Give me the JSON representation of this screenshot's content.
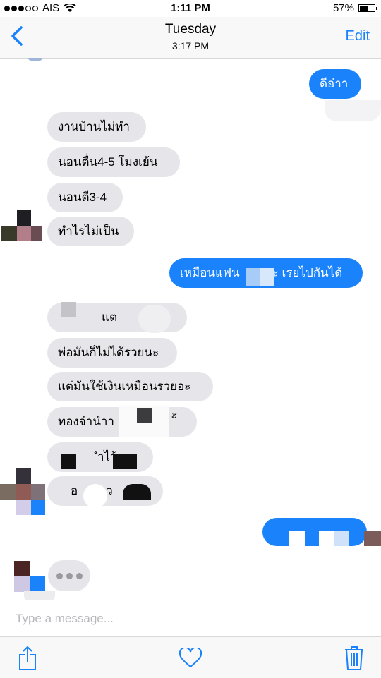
{
  "status": {
    "carrier": "AIS",
    "time": "1:11 PM",
    "battery": "57%",
    "battery_level": 0.57
  },
  "nav": {
    "title": "Tuesday",
    "subtitle": "3:17 PM",
    "edit_label": "Edit",
    "back_icon": "chevron-left-icon"
  },
  "messages": {
    "m1": "ดีอ่าา",
    "m2": "งานบ้านไม่ทำ",
    "m3": "นอนตื่น4-5 โมงเย้น",
    "m4": "นอนตี3-4",
    "m5": "ทำไรไม่เป็น",
    "m6": "เหมือนแฟน",
    "m6b": "ะ เรยไปกันได้",
    "m7": "แต",
    "m8": "พ่อมันก็ไม่ได้รวยนะ",
    "m9": "แต่มันใช้เงินเหมือนรวยอะ",
    "m10": "ทองจำนำา",
    "m10b": "ั้",
    "m11": "ำไว้",
    "m12": "อ",
    "m12b": "ว"
  },
  "input": {
    "placeholder": "Type a message..."
  },
  "toolbar": {
    "share_icon": "share-icon",
    "heart_icon": "heart-icon",
    "trash_icon": "trash-icon"
  },
  "colors": {
    "accent": "#1a82fb",
    "incoming_bubble": "#e6e6ea",
    "outgoing_bubble": "#1a82fb"
  }
}
